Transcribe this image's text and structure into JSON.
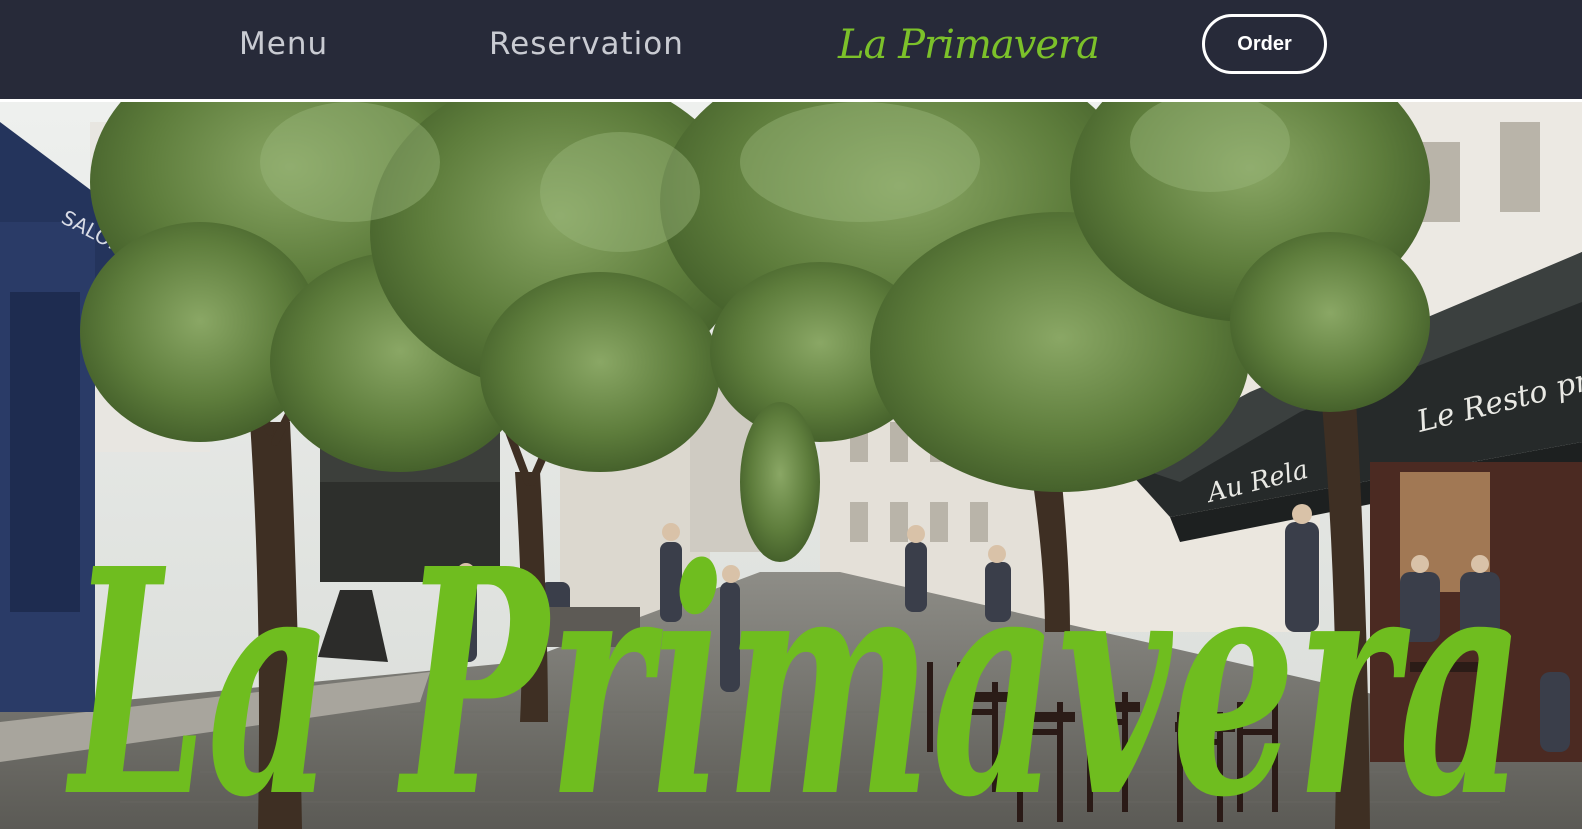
{
  "header": {
    "nav": {
      "menu_label": "Menu",
      "reservation_label": "Reservation"
    },
    "brand": "La Primavera",
    "order_label": "Order"
  },
  "hero": {
    "title": "La Primavera",
    "awning_left_text": "SALON DE THÉ",
    "awning_right_text": "Le Resto pr",
    "awning_right_lower_text": "Au Rela",
    "sign_text": "Au Rela"
  },
  "colors": {
    "header_bg": "#272a39",
    "nav_text": "#c9cbd2",
    "brand_green": "#7cc12a",
    "hero_title_green": "#6fbd1f",
    "order_border": "#ffffff"
  },
  "icons": {
    "hero_image": "street-cafe-photo"
  }
}
